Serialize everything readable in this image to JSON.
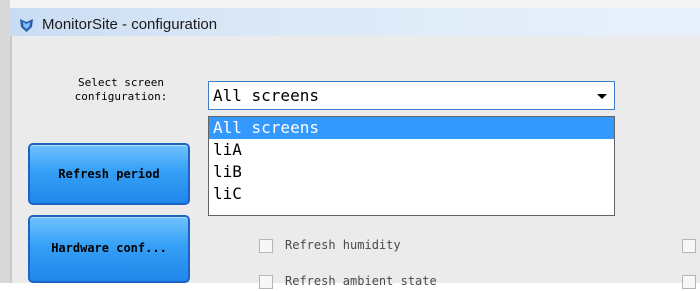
{
  "window": {
    "title": "MonitorSite - configuration",
    "app_icon": "shield-logo-icon"
  },
  "configuration": {
    "label_line1": "Select screen",
    "label_line2": "configuration:",
    "selected_value": "All screens",
    "options": [
      "All screens",
      "liA",
      "liB",
      "liC"
    ],
    "highlighted_option": "All screens"
  },
  "sidebar": {
    "buttons": [
      "Refresh period",
      "Hardware conf..."
    ]
  },
  "checkboxes": [
    {
      "label": "Refresh humidity",
      "checked": false
    },
    {
      "label": "Refresh ambient state",
      "checked": false
    }
  ],
  "colors": {
    "accent": "#3399ff",
    "button_blue": "#2f95f0",
    "title_bar": "#dbe8f7"
  }
}
